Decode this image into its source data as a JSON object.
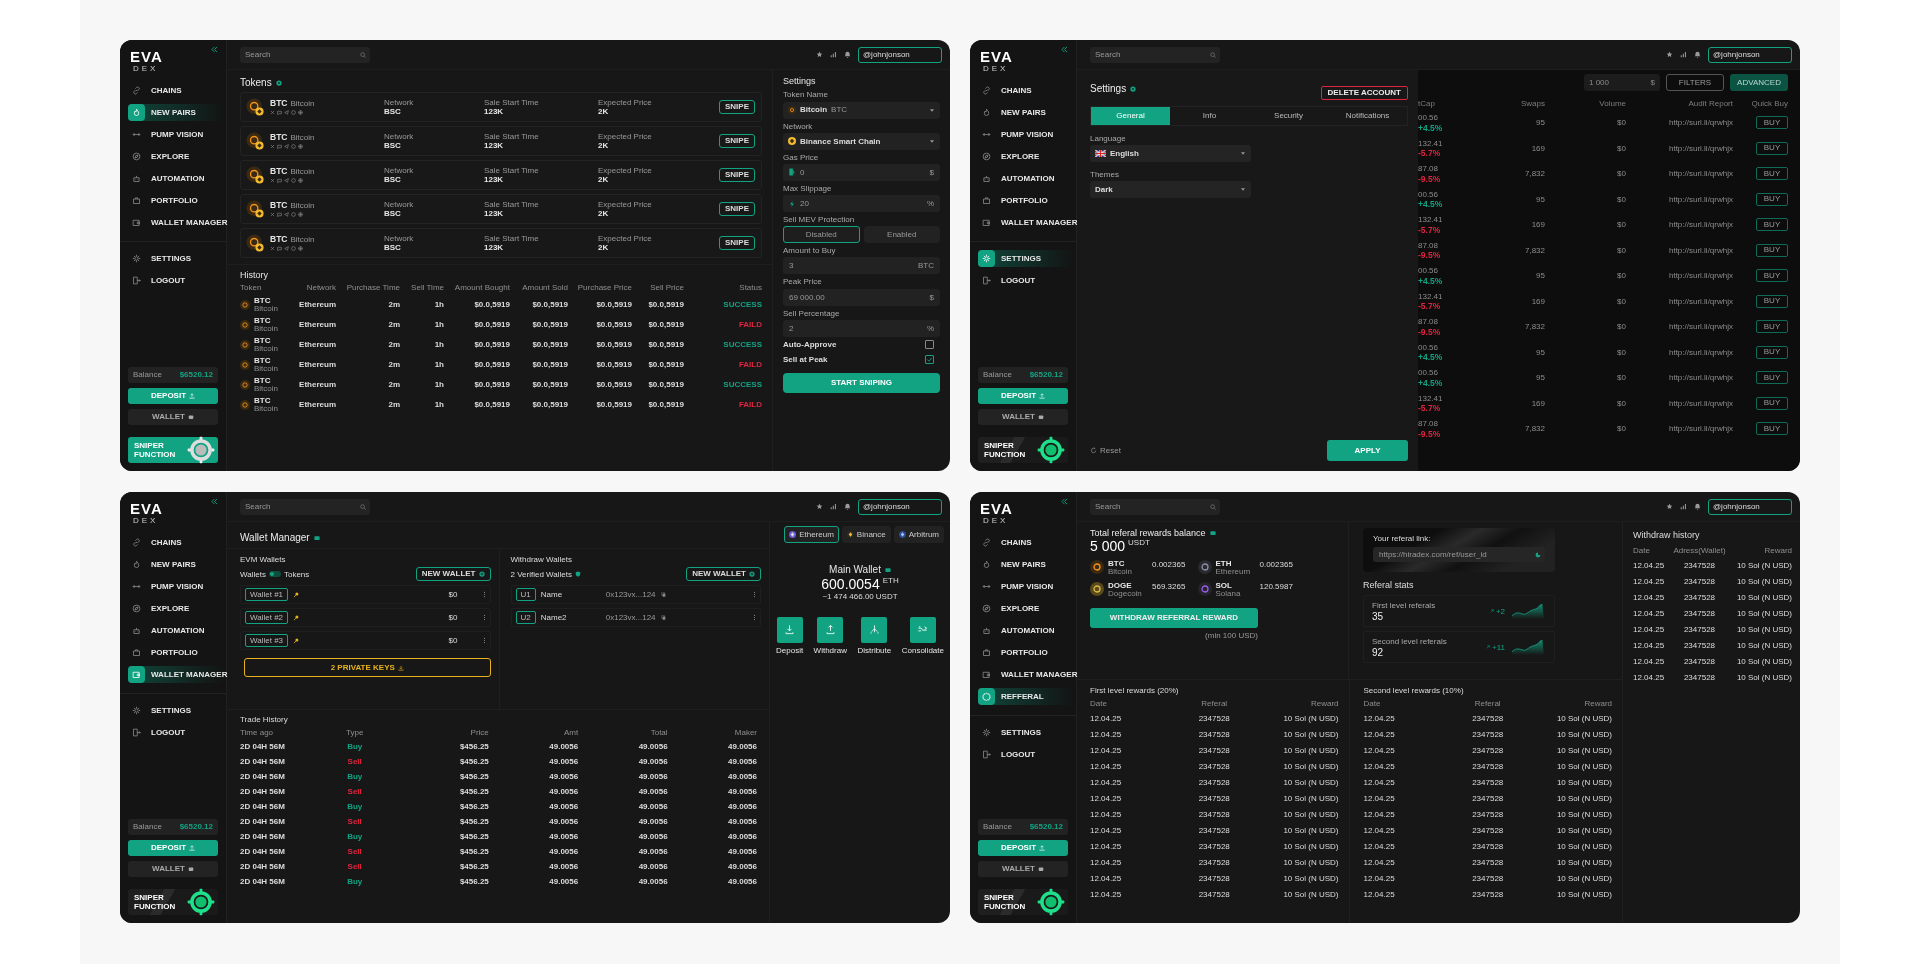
{
  "panels": [
    {
      "kind": "tokens",
      "sidebar": {
        "logo": "EVA",
        "logo_sub": "DEX",
        "items": [
          {
            "label": "CHAINS",
            "selected": false
          },
          {
            "label": "NEW PAIRS",
            "selected": true
          },
          {
            "label": "PUMP VISION",
            "selected": false
          },
          {
            "label": "EXPLORE",
            "selected": false
          },
          {
            "label": "AUTOMATION",
            "selected": false
          },
          {
            "label": "PORTFOLIO",
            "selected": false
          },
          {
            "label": "WALLET MANAGER",
            "selected": false
          }
        ],
        "bottom": [
          {
            "label": "SETTINGS",
            "selected": false
          },
          {
            "label": "LOGOUT",
            "selected": false
          }
        ],
        "balance_label": "Balance",
        "balance": "$6520.12",
        "deposit": "DEPOSIT",
        "wallet": "WALLET",
        "sniper": "SNIPER FUNCTION",
        "sniper_highlighted": true
      },
      "topbar": {
        "search": {
          "placeholder": "Search"
        },
        "user": "@johnjonson"
      },
      "tokens": {
        "title": "Tokens",
        "rows": [
          {
            "symbol": "BTC",
            "name": "Bitcoin",
            "network_label": "Network",
            "network": "BSC",
            "start_label": "Sale Start Time",
            "start": "123K",
            "price_label": "Expected Price",
            "price": "2K",
            "action": "SNIPE"
          },
          {
            "symbol": "BTC",
            "name": "Bitcoin",
            "network_label": "Network",
            "network": "BSC",
            "start_label": "Sale Start Time",
            "start": "123K",
            "price_label": "Expected Price",
            "price": "2K",
            "action": "SNIPE"
          },
          {
            "symbol": "BTC",
            "name": "Bitcoin",
            "network_label": "Network",
            "network": "BSC",
            "start_label": "Sale Start Time",
            "start": "123K",
            "price_label": "Expected Price",
            "price": "2K",
            "action": "SNIPE"
          },
          {
            "symbol": "BTC",
            "name": "Bitcoin",
            "network_label": "Network",
            "network": "BSC",
            "start_label": "Sale Start Time",
            "start": "123K",
            "price_label": "Expected Price",
            "price": "2K",
            "action": "SNIPE"
          },
          {
            "symbol": "BTC",
            "name": "Bitcoin",
            "network_label": "Network",
            "network": "BSC",
            "start_label": "Sale Start Time",
            "start": "123K",
            "price_label": "Expected Price",
            "price": "2K",
            "action": "SNIPE"
          }
        ]
      },
      "history": {
        "title": "History",
        "columns": [
          "Token",
          "Network",
          "Purchase Time",
          "Sell Time",
          "Amount Bought",
          "Amount Sold",
          "Purchase Price",
          "Sell Price",
          "Status"
        ],
        "rows": [
          {
            "symbol": "BTC",
            "name": "Bitcoin",
            "network": "Ethereum",
            "purchase_time": "2m",
            "sell_time": "1h",
            "amount_bought": "$0.0,5919",
            "amount_sold": "$0.0,5919",
            "purchase_price": "$0.0,5919",
            "sell_price": "$0.0,5919",
            "status": "SUCCESS",
            "color": "#12a383"
          },
          {
            "symbol": "BTC",
            "name": "Bitcoin",
            "network": "Ethereum",
            "purchase_time": "2m",
            "sell_time": "1h",
            "amount_bought": "$0.0,5919",
            "amount_sold": "$0.0,5919",
            "purchase_price": "$0.0,5919",
            "sell_price": "$0.0,5919",
            "status": "FAILD",
            "color": "#e1243f"
          },
          {
            "symbol": "BTC",
            "name": "Bitcoin",
            "network": "Ethereum",
            "purchase_time": "2m",
            "sell_time": "1h",
            "amount_bought": "$0.0,5919",
            "amount_sold": "$0.0,5919",
            "purchase_price": "$0.0,5919",
            "sell_price": "$0.0,5919",
            "status": "SUCCESS",
            "color": "#12a383"
          },
          {
            "symbol": "BTC",
            "name": "Bitcoin",
            "network": "Ethereum",
            "purchase_time": "2m",
            "sell_time": "1h",
            "amount_bought": "$0.0,5919",
            "amount_sold": "$0.0,5919",
            "purchase_price": "$0.0,5919",
            "sell_price": "$0.0,5919",
            "status": "FAILD",
            "color": "#e1243f"
          },
          {
            "symbol": "BTC",
            "name": "Bitcoin",
            "network": "Ethereum",
            "purchase_time": "2m",
            "sell_time": "1h",
            "amount_bought": "$0.0,5919",
            "amount_sold": "$0.0,5919",
            "purchase_price": "$0.0,5919",
            "sell_price": "$0.0,5919",
            "status": "SUCCESS",
            "color": "#12a383"
          },
          {
            "symbol": "BTC",
            "name": "Bitcoin",
            "network": "Ethereum",
            "purchase_time": "2m",
            "sell_time": "1h",
            "amount_bought": "$0.0,5919",
            "amount_sold": "$0.0,5919",
            "purchase_price": "$0.0,5919",
            "sell_price": "$0.0,5919",
            "status": "FAILD",
            "color": "#e1243f"
          }
        ]
      },
      "settings": {
        "title": "Settings",
        "fields": [
          {
            "kind": "select",
            "label": "Token Name",
            "value": "Bitcoin",
            "unit": "BTC"
          },
          {
            "kind": "select",
            "label": "Network",
            "value": "Binance Smart Chain"
          },
          {
            "kind": "input",
            "label": "Gas Price",
            "placeholder": "0",
            "unit": "$"
          },
          {
            "kind": "input",
            "label": "Max Slippage",
            "placeholder": "20",
            "unit": "%"
          },
          {
            "kind": "toggle",
            "label": "Sell MEV Protection",
            "options": [
              {
                "label": "Disabled",
                "selected": true
              },
              {
                "label": "Enabled",
                "selected": false
              }
            ]
          },
          {
            "kind": "input",
            "label": "Amount to Buy",
            "placeholder": "3",
            "unit": "BTC"
          },
          {
            "kind": "input",
            "label": "Peak Price",
            "placeholder": "69 000.00",
            "unit": "$"
          },
          {
            "kind": "input",
            "label": "Sell Percentage",
            "placeholder": "2",
            "unit": "%"
          },
          {
            "kind": "checkbox",
            "label": "Auto-Approve",
            "checked": false
          },
          {
            "kind": "checkbox",
            "label": "Sell at Peak",
            "checked": true
          }
        ],
        "submit": "START SNIPING"
      }
    },
    {
      "kind": "settings",
      "sidebar": {
        "logo": "EVA",
        "logo_sub": "DEX",
        "items": [
          {
            "label": "CHAINS",
            "selected": false
          },
          {
            "label": "NEW PAIRS",
            "selected": false
          },
          {
            "label": "PUMP VISION",
            "selected": false
          },
          {
            "label": "EXPLORE",
            "selected": false
          },
          {
            "label": "AUTOMATION",
            "selected": false
          },
          {
            "label": "PORTFOLIO",
            "selected": false
          },
          {
            "label": "WALLET MANAGER",
            "selected": false
          }
        ],
        "bottom": [
          {
            "label": "SETTINGS",
            "selected": true
          },
          {
            "label": "LOGOUT",
            "selected": false
          }
        ],
        "balance_label": "Balance",
        "balance": "$6520.12",
        "deposit": "DEPOSIT",
        "wallet": "WALLET",
        "sniper": "SNIPER FUNCTION",
        "sniper_highlighted": false
      },
      "topbar": {
        "search": {
          "placeholder": "Search"
        },
        "user": "@johnjonson"
      },
      "drawer": {
        "title": "Settings",
        "delete": "DELETE ACCOUNT",
        "tabs": [
          {
            "label": "General",
            "selected": true
          },
          {
            "label": "Info",
            "selected": false
          },
          {
            "label": "Security",
            "selected": false
          },
          {
            "label": "Notifications",
            "selected": false
          }
        ],
        "fields": [
          {
            "label": "Language",
            "value": "English"
          },
          {
            "label": "Themes",
            "value": "Dark"
          }
        ],
        "reset": "Reset",
        "apply": "APPLY"
      },
      "background_table": {
        "amount": "1 000",
        "currency": "$",
        "filters": "FILTERS",
        "advanced": "ADVANCED",
        "columns": [
          "tCap",
          "Swaps",
          "Volume",
          "Audit Report",
          "Quick Buy"
        ],
        "rows": [
          {
            "cap": "00.56",
            "change": "+4.5%",
            "color": "#12a383",
            "swaps": "95",
            "volume": "$0",
            "audit": "http://surl.li/qrwhjx",
            "action": "BUY"
          },
          {
            "cap": "132.41",
            "change": "-5.7%",
            "color": "#e1243f",
            "swaps": "169",
            "volume": "$0",
            "audit": "http://surl.li/qrwhjx",
            "action": "BUY"
          },
          {
            "cap": "87.08",
            "change": "-9.5%",
            "color": "#e1243f",
            "swaps": "7,832",
            "volume": "$0",
            "audit": "http://surl.li/qrwhjx",
            "action": "BUY"
          },
          {
            "cap": "00.56",
            "change": "+4.5%",
            "color": "#12a383",
            "swaps": "95",
            "volume": "$0",
            "audit": "http://surl.li/qrwhjx",
            "action": "BUY"
          },
          {
            "cap": "132.41",
            "change": "-5.7%",
            "color": "#e1243f",
            "swaps": "169",
            "volume": "$0",
            "audit": "http://surl.li/qrwhjx",
            "action": "BUY"
          },
          {
            "cap": "87.08",
            "change": "-9.5%",
            "color": "#e1243f",
            "swaps": "7,832",
            "volume": "$0",
            "audit": "http://surl.li/qrwhjx",
            "action": "BUY"
          },
          {
            "cap": "00.56",
            "change": "+4.5%",
            "color": "#12a383",
            "swaps": "95",
            "volume": "$0",
            "audit": "http://surl.li/qrwhjx",
            "action": "BUY"
          },
          {
            "cap": "132.41",
            "change": "-5.7%",
            "color": "#e1243f",
            "swaps": "169",
            "volume": "$0",
            "audit": "http://surl.li/qrwhjx",
            "action": "BUY"
          },
          {
            "cap": "87.08",
            "change": "-9.5%",
            "color": "#e1243f",
            "swaps": "7,832",
            "volume": "$0",
            "audit": "http://surl.li/qrwhjx",
            "action": "BUY"
          },
          {
            "cap": "00.56",
            "change": "+4.5%",
            "color": "#12a383",
            "swaps": "95",
            "volume": "$0",
            "audit": "http://surl.li/qrwhjx",
            "action": "BUY"
          },
          {
            "cap": "00.56",
            "change": "+4.5%",
            "color": "#12a383",
            "swaps": "95",
            "volume": "$0",
            "audit": "http://surl.li/qrwhjx",
            "action": "BUY"
          },
          {
            "cap": "132.41",
            "change": "-5.7%",
            "color": "#e1243f",
            "swaps": "169",
            "volume": "$0",
            "audit": "http://surl.li/qrwhjx",
            "action": "BUY"
          },
          {
            "cap": "87.08",
            "change": "-9.5%",
            "color": "#e1243f",
            "swaps": "7,832",
            "volume": "$0",
            "audit": "http://surl.li/qrwhjx",
            "action": "BUY"
          }
        ]
      }
    },
    {
      "kind": "wallet",
      "sidebar": {
        "logo": "EVA",
        "logo_sub": "DEX",
        "items": [
          {
            "label": "CHAINS",
            "selected": false
          },
          {
            "label": "NEW PAIRS",
            "selected": false
          },
          {
            "label": "PUMP VISION",
            "selected": false
          },
          {
            "label": "EXPLORE",
            "selected": false
          },
          {
            "label": "AUTOMATION",
            "selected": false
          },
          {
            "label": "PORTFOLIO",
            "selected": false
          },
          {
            "label": "WALLET MANAGER",
            "selected": true
          }
        ],
        "bottom": [
          {
            "label": "SETTINGS",
            "selected": false
          },
          {
            "label": "LOGOUT",
            "selected": false
          }
        ],
        "balance_label": "Balance",
        "balance": "$6520.12",
        "deposit": "DEPOSIT",
        "wallet": "WALLET",
        "sniper": "SNIPER FUNCTION",
        "sniper_highlighted": false
      },
      "topbar": {
        "search": {
          "placeholder": "Search"
        },
        "user": "@johnjonson"
      },
      "title": "Wallet Manager",
      "chains": [
        {
          "label": "Ethereum",
          "selected": true
        },
        {
          "label": "Binance",
          "selected": false
        },
        {
          "label": "Arbitrum",
          "selected": false
        }
      ],
      "evm": {
        "title": "EVM Wallets",
        "switch": {
          "left": "Wallets",
          "right": "Tokens",
          "on": false
        },
        "new": "NEW WALLET",
        "rows": [
          {
            "tag": "Wallet #1",
            "amount": "$0"
          },
          {
            "tag": "Wallet #2",
            "amount": "$0"
          },
          {
            "tag": "Wallet #3",
            "amount": "$0"
          }
        ],
        "keys": "2 PRIVATE KEYS"
      },
      "withdraw": {
        "title": "Withdraw Wallets",
        "verified": "2 Verified Wallets",
        "new": "NEW WALLET",
        "rows": [
          {
            "tag": "U1",
            "name": "Name",
            "address": "0x123vx...124"
          },
          {
            "tag": "U2",
            "name": "Name2",
            "address": "0x123vx...124"
          }
        ]
      },
      "main_wallet": {
        "title": "Main Wallet",
        "amount": "600.0054",
        "unit": "ETH",
        "fiat": "~1 474 466.00",
        "fiat_unit": "USDT",
        "actions": [
          "Deposit",
          "Withdraw",
          "Distribute",
          "Consolidate"
        ]
      },
      "trades": {
        "title": "Trade History",
        "columns": [
          "Time ago",
          "Type",
          "Price",
          "Amt",
          "Total",
          "Maker"
        ],
        "rows": [
          {
            "time": "2D 04H 56M",
            "type": "Buy",
            "color": "#12a383",
            "price": "$456.25",
            "amt": "49.0056",
            "total": "49.0056",
            "maker": "49.0056"
          },
          {
            "time": "2D 04H 56M",
            "type": "Sell",
            "color": "#e1243f",
            "price": "$456.25",
            "amt": "49.0056",
            "total": "49.0056",
            "maker": "49.0056"
          },
          {
            "time": "2D 04H 56M",
            "type": "Buy",
            "color": "#12a383",
            "price": "$456.25",
            "amt": "49.0056",
            "total": "49.0056",
            "maker": "49.0056"
          },
          {
            "time": "2D 04H 56M",
            "type": "Sell",
            "color": "#e1243f",
            "price": "$456.25",
            "amt": "49.0056",
            "total": "49.0056",
            "maker": "49.0056"
          },
          {
            "time": "2D 04H 56M",
            "type": "Buy",
            "color": "#12a383",
            "price": "$456.25",
            "amt": "49.0056",
            "total": "49.0056",
            "maker": "49.0056"
          },
          {
            "time": "2D 04H 56M",
            "type": "Sell",
            "color": "#e1243f",
            "price": "$456.25",
            "amt": "49.0056",
            "total": "49.0056",
            "maker": "49.0056"
          },
          {
            "time": "2D 04H 56M",
            "type": "Buy",
            "color": "#12a383",
            "price": "$456.25",
            "amt": "49.0056",
            "total": "49.0056",
            "maker": "49.0056"
          },
          {
            "time": "2D 04H 56M",
            "type": "Sell",
            "color": "#e1243f",
            "price": "$456.25",
            "amt": "49.0056",
            "total": "49.0056",
            "maker": "49.0056"
          },
          {
            "time": "2D 04H 56M",
            "type": "Sell",
            "color": "#e1243f",
            "price": "$456.25",
            "amt": "49.0056",
            "total": "49.0056",
            "maker": "49.0056"
          },
          {
            "time": "2D 04H 56M",
            "type": "Buy",
            "color": "#12a383",
            "price": "$456.25",
            "amt": "49.0056",
            "total": "49.0056",
            "maker": "49.0056"
          }
        ]
      }
    },
    {
      "kind": "referral",
      "sidebar": {
        "logo": "EVA",
        "logo_sub": "DEX",
        "items": [
          {
            "label": "CHAINS",
            "selected": false
          },
          {
            "label": "NEW PAIRS",
            "selected": false
          },
          {
            "label": "PUMP VISION",
            "selected": false
          },
          {
            "label": "EXPLORE",
            "selected": false
          },
          {
            "label": "AUTOMATION",
            "selected": false
          },
          {
            "label": "PORTFOLIO",
            "selected": false
          },
          {
            "label": "WALLET MANAGER",
            "selected": false
          },
          {
            "label": "REFFERAL",
            "selected": true
          }
        ],
        "bottom": [
          {
            "label": "SETTINGS",
            "selected": false
          },
          {
            "label": "LOGOUT",
            "selected": false
          }
        ],
        "balance_label": "Balance",
        "balance": "$6520.12",
        "deposit": "DEPOSIT",
        "wallet": "WALLET",
        "sniper": "SNIPER FUNCTION",
        "sniper_highlighted": false
      },
      "topbar": {
        "search": {
          "placeholder": "Search"
        },
        "user": "@johnjonson"
      },
      "balance": {
        "title": "Total referal rewards balance",
        "amount": "5 000",
        "unit": "USDT",
        "assets": [
          {
            "symbol": "BTC",
            "name": "Bitcoin",
            "amount": "0.002365"
          },
          {
            "symbol": "ETH",
            "name": "Ethereum",
            "amount": "0.002365"
          },
          {
            "symbol": "DOGE",
            "name": "Dogecoin",
            "amount": "569.3265"
          },
          {
            "symbol": "SOL",
            "name": "Solana",
            "amount": "120.5987"
          }
        ],
        "button": "WITHDRAW REFERRAL REWARD",
        "note": "(min 100 USD)"
      },
      "link": {
        "title": "Your referal link:",
        "url": "https://hiradex.com/ref/user_id"
      },
      "stats": {
        "title": "Referal stats",
        "cards": [
          {
            "label": "First level referals",
            "value": "35",
            "delta": "+2"
          },
          {
            "label": "Second level referals",
            "value": "92",
            "delta": "+11"
          }
        ]
      },
      "tables": [
        {
          "title": "First level rewards (20%)",
          "columns": [
            "Date",
            "Referal",
            "Reward"
          ],
          "rows": [
            [
              "12.04.25",
              "2347528",
              "10 Sol (N USD)"
            ],
            [
              "12.04.25",
              "2347528",
              "10 Sol (N USD)"
            ],
            [
              "12.04.25",
              "2347528",
              "10 Sol (N USD)"
            ],
            [
              "12.04.25",
              "2347528",
              "10 Sol (N USD)"
            ],
            [
              "12.04.25",
              "2347528",
              "10 Sol (N USD)"
            ],
            [
              "12.04.25",
              "2347528",
              "10 Sol (N USD)"
            ],
            [
              "12.04.25",
              "2347528",
              "10 Sol (N USD)"
            ],
            [
              "12.04.25",
              "2347528",
              "10 Sol (N USD)"
            ],
            [
              "12.04.25",
              "2347528",
              "10 Sol (N USD)"
            ],
            [
              "12.04.25",
              "2347528",
              "10 Sol (N USD)"
            ],
            [
              "12.04.25",
              "2347528",
              "10 Sol (N USD)"
            ],
            [
              "12.04.25",
              "2347528",
              "10 Sol (N USD)"
            ]
          ]
        },
        {
          "title": "Second level rewards (10%)",
          "columns": [
            "Date",
            "Referal",
            "Reward"
          ],
          "rows": [
            [
              "12.04.25",
              "2347528",
              "10 Sol (N USD)"
            ],
            [
              "12.04.25",
              "2347528",
              "10 Sol (N USD)"
            ],
            [
              "12.04.25",
              "2347528",
              "10 Sol (N USD)"
            ],
            [
              "12.04.25",
              "2347528",
              "10 Sol (N USD)"
            ],
            [
              "12.04.25",
              "2347528",
              "10 Sol (N USD)"
            ],
            [
              "12.04.25",
              "2347528",
              "10 Sol (N USD)"
            ],
            [
              "12.04.25",
              "2347528",
              "10 Sol (N USD)"
            ],
            [
              "12.04.25",
              "2347528",
              "10 Sol (N USD)"
            ],
            [
              "12.04.25",
              "2347528",
              "10 Sol (N USD)"
            ],
            [
              "12.04.25",
              "2347528",
              "10 Sol (N USD)"
            ],
            [
              "12.04.25",
              "2347528",
              "10 Sol (N USD)"
            ],
            [
              "12.04.25",
              "2347528",
              "10 Sol (N USD)"
            ]
          ]
        }
      ],
      "withdraw_history": {
        "title": "Withdraw history",
        "columns": [
          "Date",
          "Adress(Wallet)",
          "Reward"
        ],
        "rows": [
          [
            "12.04.25",
            "2347528",
            "10 Sol (N USD)"
          ],
          [
            "12.04.25",
            "2347528",
            "10 Sol (N USD)"
          ],
          [
            "12.04.25",
            "2347528",
            "10 Sol (N USD)"
          ],
          [
            "12.04.25",
            "2347528",
            "10 Sol (N USD)"
          ],
          [
            "12.04.25",
            "2347528",
            "10 Sol (N USD)"
          ],
          [
            "12.04.25",
            "2347528",
            "10 Sol (N USD)"
          ],
          [
            "12.04.25",
            "2347528",
            "10 Sol (N USD)"
          ],
          [
            "12.04.25",
            "2347528",
            "10 Sol (N USD)"
          ]
        ]
      }
    }
  ]
}
